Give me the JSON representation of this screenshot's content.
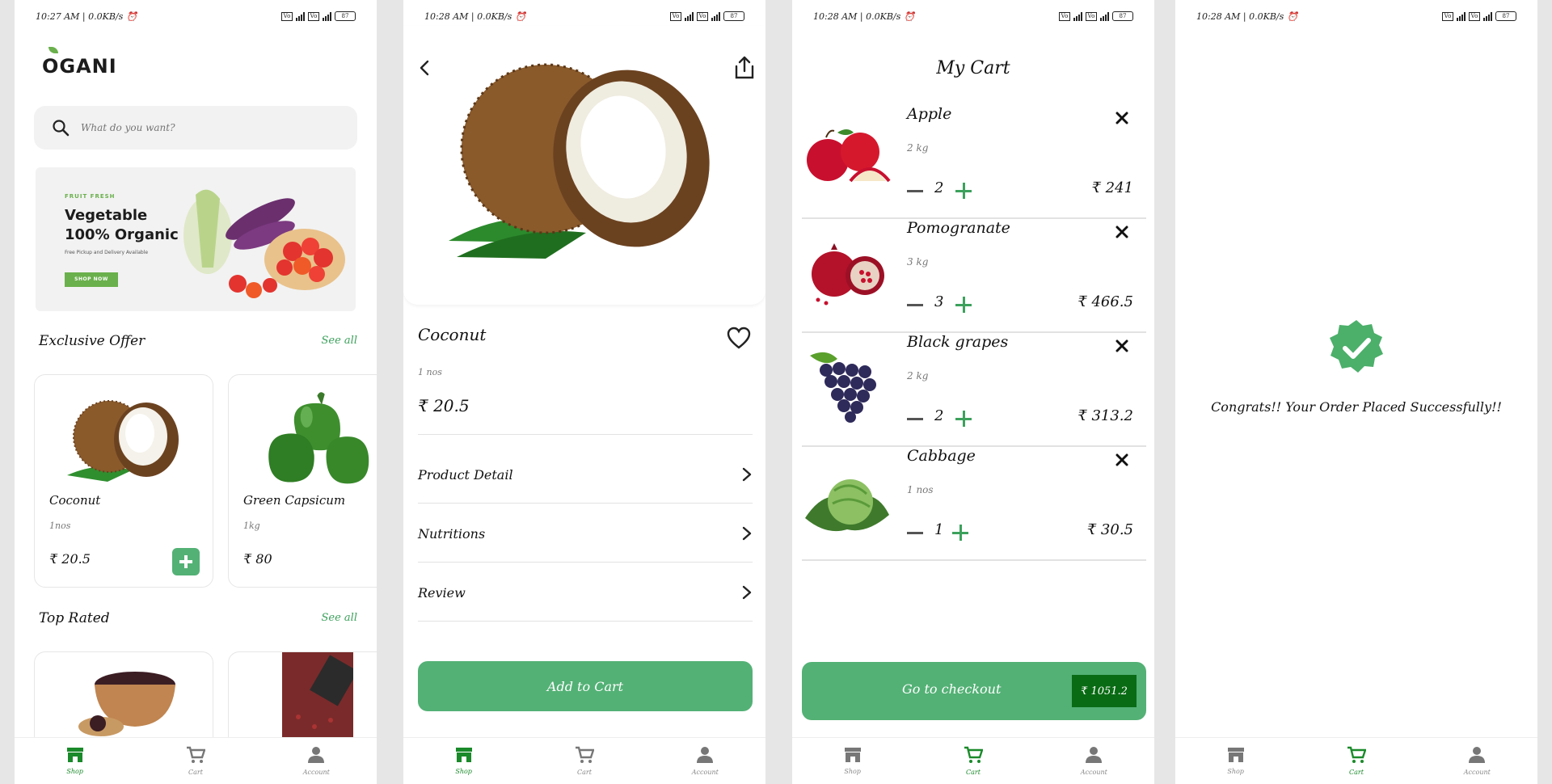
{
  "status": {
    "time_1": "10:27 AM | 0.0KB/s",
    "time_2": "10:28 AM | 0.0KB/s",
    "time_3": "10:28 AM | 0.0KB/s",
    "time_4": "10:28 AM | 0.0KB/s",
    "volte": "Vo",
    "battery": "87"
  },
  "home": {
    "logo": "OGANI",
    "search_placeholder": "What do you want?",
    "banner": {
      "tag": "FRUIT FRESH",
      "title": "Vegetable 100% Organic",
      "subtitle": "Free Pickup and Delivery Available",
      "button": "SHOP NOW"
    },
    "exclusive_title": "Exclusive Offer",
    "exclusive_see_all": "See all",
    "top_rated_title": "Top Rated",
    "top_rated_see_all": "See all",
    "products": [
      {
        "name": "Coconut",
        "qty": "1nos",
        "price": "₹ 20.5"
      },
      {
        "name": "Green Capsicum",
        "qty": "1kg",
        "price": "₹ 80"
      }
    ]
  },
  "nav": {
    "shop": "Shop",
    "cart": "Cart",
    "account": "Account"
  },
  "detail": {
    "name": "Coconut",
    "qty": "1 nos",
    "price": "₹ 20.5",
    "rows": [
      "Product Detail",
      "Nutritions",
      "Review"
    ],
    "add_to_cart": "Add to Cart"
  },
  "cart": {
    "title": "My Cart",
    "items": [
      {
        "name": "Apple",
        "qty": "2 kg",
        "count": "2",
        "price": "₹ 241"
      },
      {
        "name": "Pomogranate",
        "qty": "3 kg",
        "count": "3",
        "price": "₹ 466.5"
      },
      {
        "name": "Black grapes",
        "qty": "2 kg",
        "count": "2",
        "price": "₹ 313.2"
      },
      {
        "name": "Cabbage",
        "qty": "1 nos",
        "count": "1",
        "price": "₹ 30.5"
      }
    ],
    "checkout_label": "Go to checkout",
    "total": "₹ 1051.2"
  },
  "success": {
    "message": "Congrats!! Your Order Placed Successfully!!"
  },
  "colors": {
    "accent": "#53b175",
    "dark_green": "#096b14",
    "nav_active": "#1a8a2a"
  }
}
